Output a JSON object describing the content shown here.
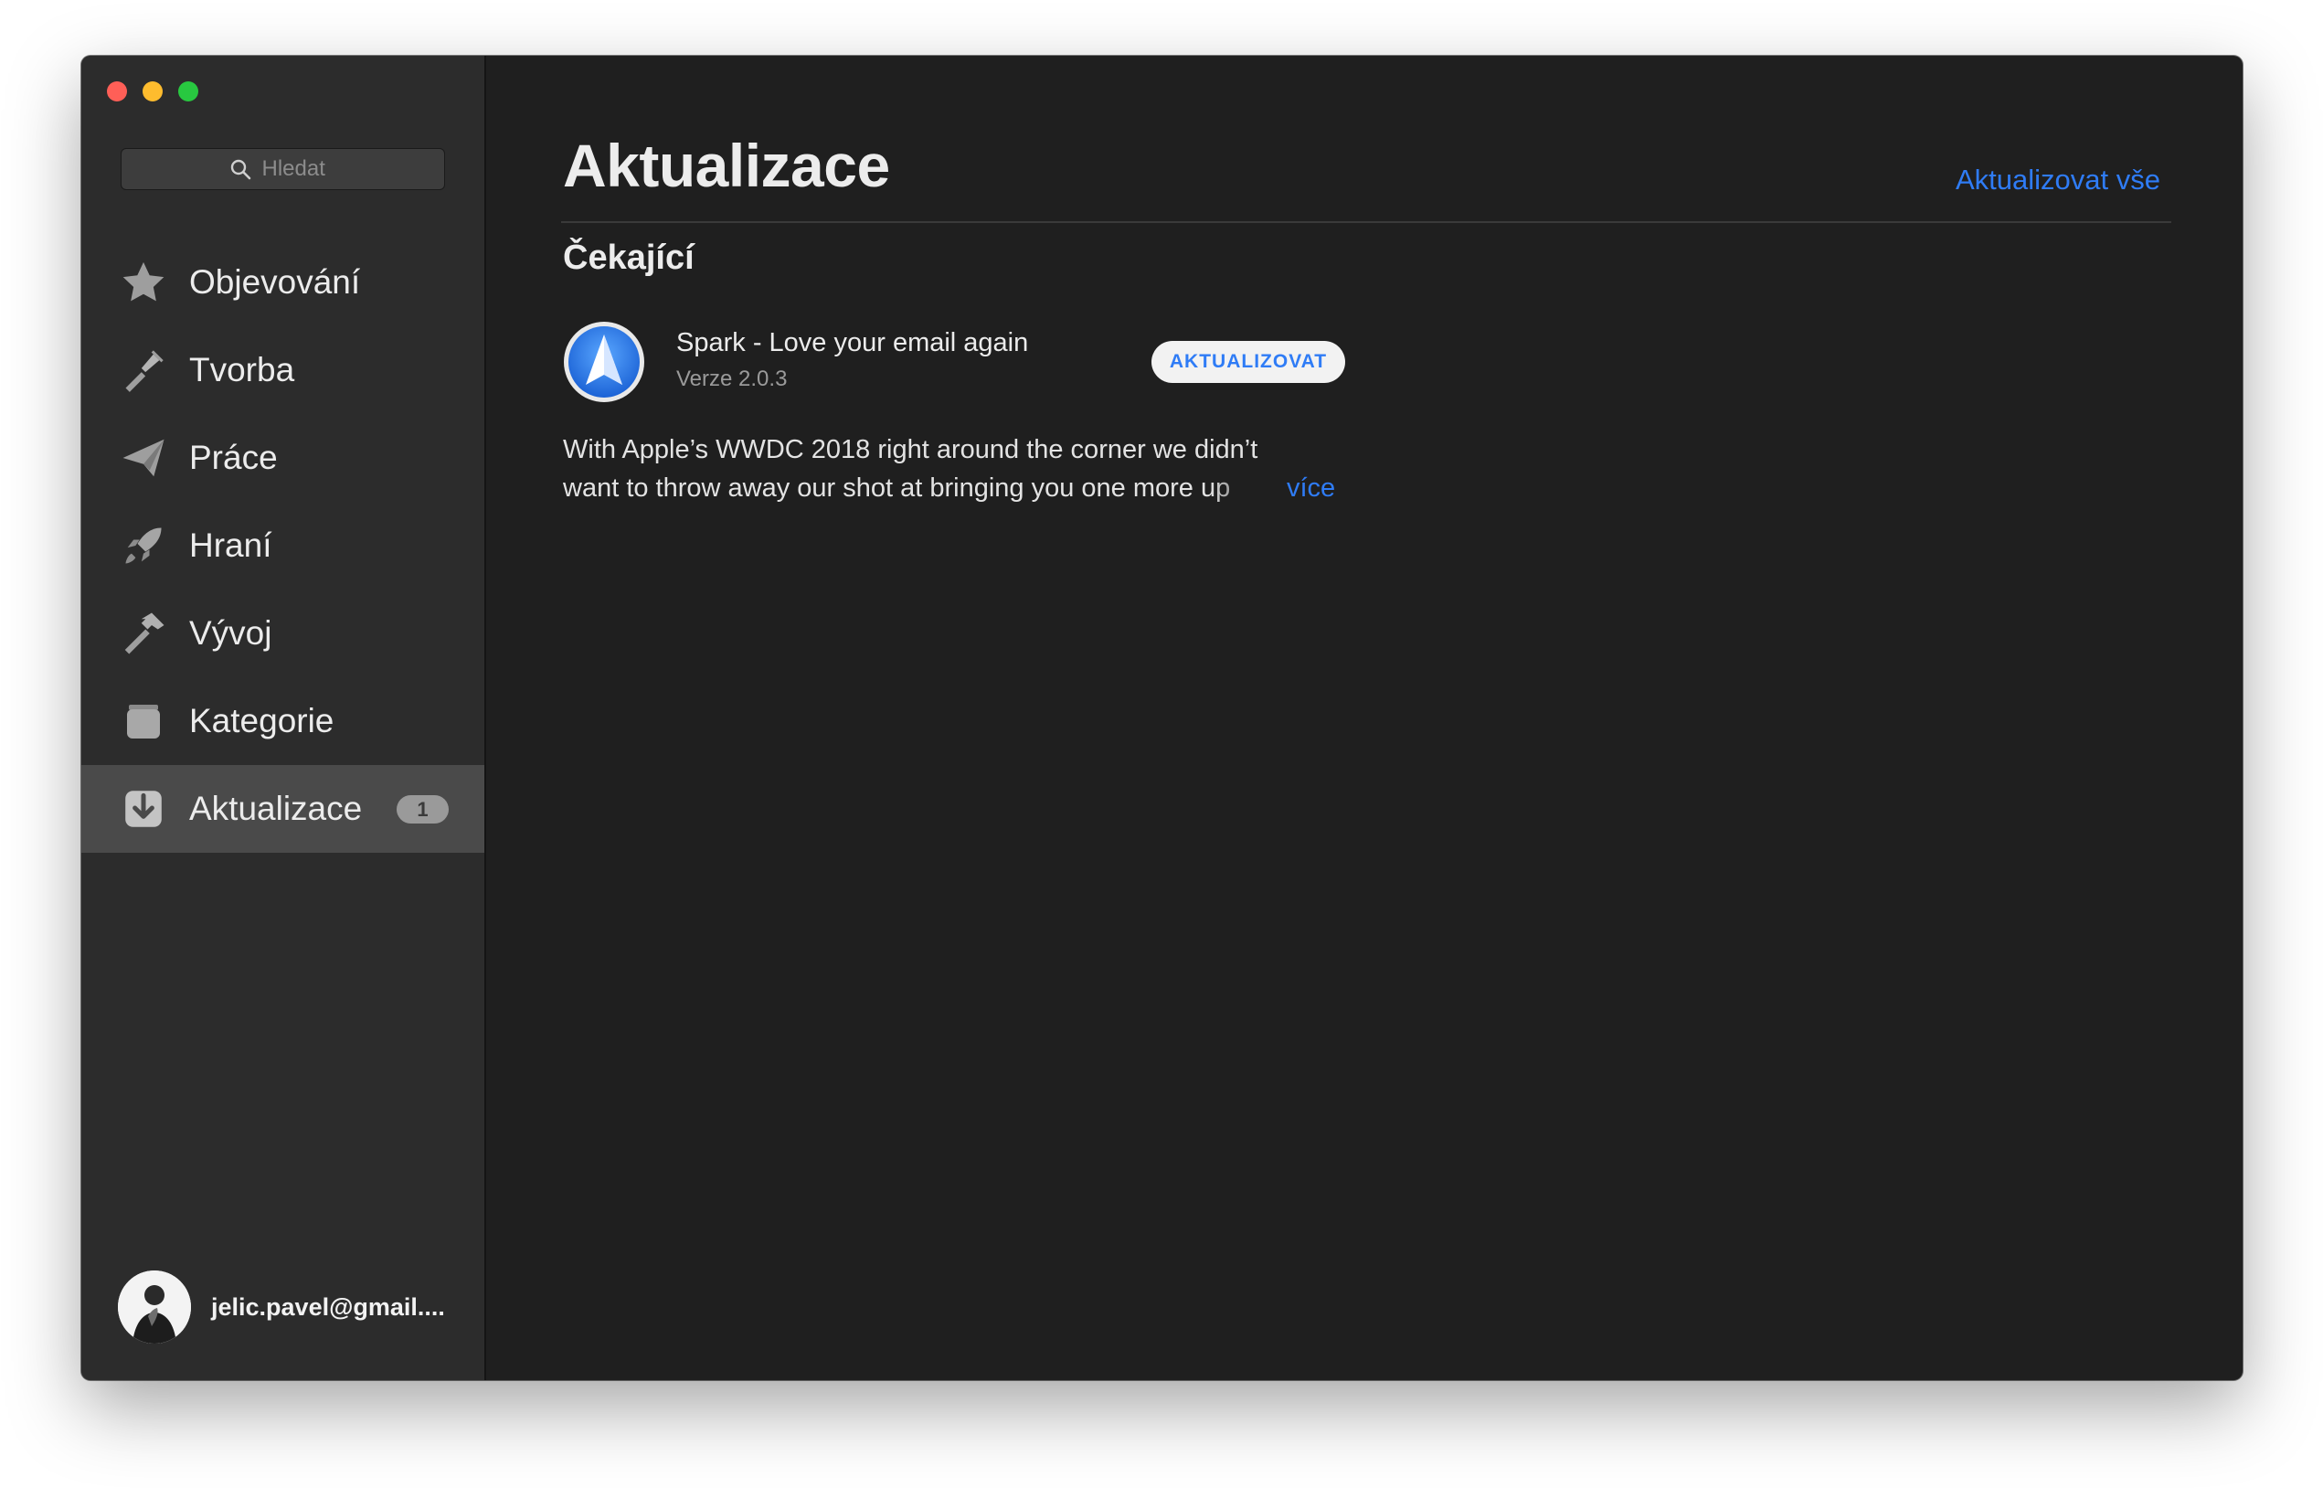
{
  "window": {
    "controls": [
      "close",
      "minimize",
      "zoom"
    ]
  },
  "sidebar": {
    "search": {
      "placeholder": "Hledat",
      "value": "",
      "icon": "search-icon"
    },
    "items": [
      {
        "label": "Objevování",
        "icon": "star-icon",
        "active": false
      },
      {
        "label": "Tvorba",
        "icon": "brush-icon",
        "active": false
      },
      {
        "label": "Práce",
        "icon": "paper-plane-icon",
        "active": false
      },
      {
        "label": "Hraní",
        "icon": "rocket-icon",
        "active": false
      },
      {
        "label": "Vývoj",
        "icon": "hammer-icon",
        "active": false
      },
      {
        "label": "Kategorie",
        "icon": "box-icon",
        "active": false
      },
      {
        "label": "Aktualizace",
        "icon": "download-icon",
        "active": true,
        "badge": "1"
      }
    ],
    "account": {
      "email": "jelic.pavel@gmail...."
    }
  },
  "main": {
    "title": "Aktualizace",
    "update_all_label": "Aktualizovat vše",
    "section_title": "Čekající",
    "app": {
      "name": "Spark - Love your email again",
      "version": "Verze 2.0.3",
      "update_button": "AKTUALIZOVAT",
      "icon": "spark-app-icon",
      "description_line1": "With Apple’s WWDC 2018 right around the corner we didn’t",
      "description_line2": "want to throw away our shot at bringing you one more up",
      "more_label": "více"
    }
  },
  "colors": {
    "accent": "#2f7cf6",
    "sidebar_bg": "#2c2c2c",
    "main_bg": "#1f1f1f"
  }
}
